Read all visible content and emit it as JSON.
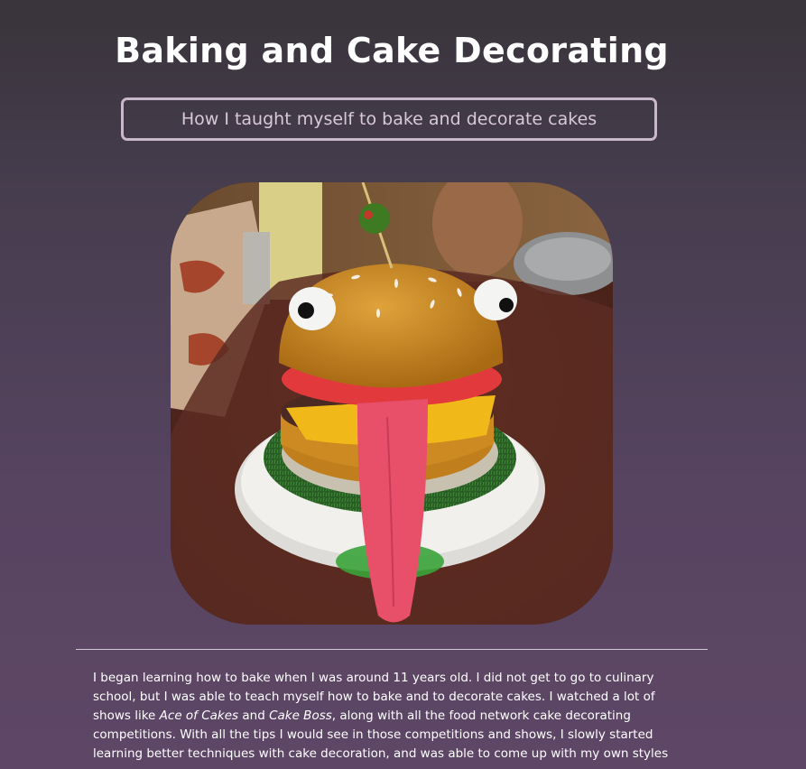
{
  "header": {
    "title": "Baking and Cake Decorating",
    "subtitle": "How I taught myself to bake and decorate cakes"
  },
  "hero_image": {
    "subject": "burger-shaped cake with eyes and tongue",
    "colors": {
      "bun": "#c98a22",
      "tomato": "#e2393c",
      "cheese": "#f0b818",
      "patty": "#4a2a22",
      "tongue": "#e8506a",
      "grass": "#2f6b2a",
      "plate": "#ecebe8",
      "olive": "#3d7a22",
      "table": "#5a2c22"
    }
  },
  "article": {
    "p1_a": "I began learning how to bake when I was around 11 years old. I did not get to go to culinary school, but I was able to teach myself how to bake and to decorate cakes. I watched a lot of shows like ",
    "p1_show1": "Ace of Cakes",
    "p1_b": " and ",
    "p1_show2": "Cake Boss",
    "p1_c": ", along with all the food network cake decorating competitions. With all the tips I would see in those competitions and shows, I slowly started learning better techniques with cake decoration, and was able to come up with my own styles as"
  },
  "theme": {
    "background_top": "#39343b",
    "background_bottom": "#5e4766",
    "text": "#ffffff",
    "subtitle_border": "#c9b8cc"
  }
}
